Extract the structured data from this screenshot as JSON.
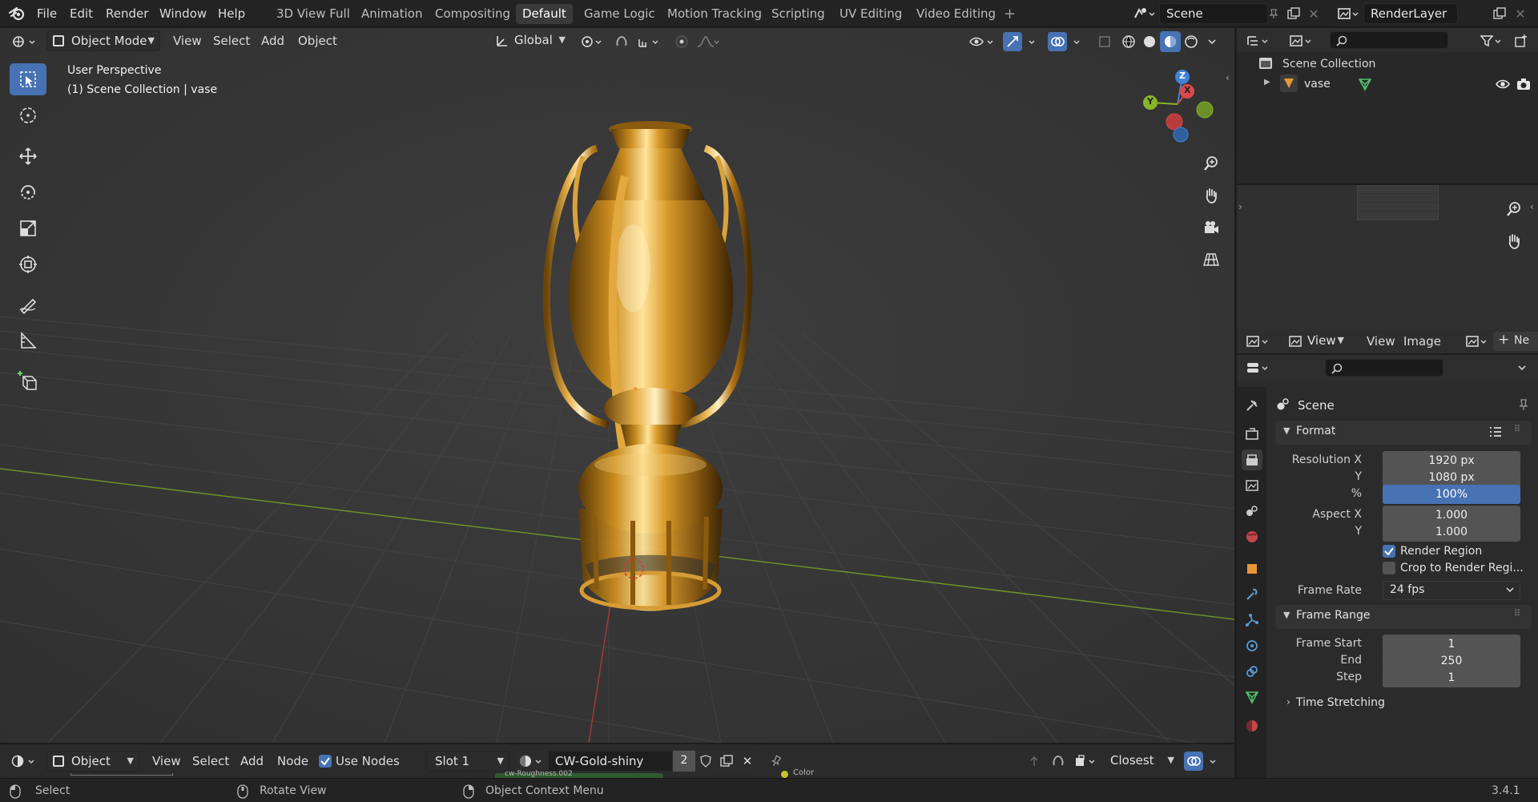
{
  "topbar": {
    "menu": [
      "File",
      "Edit",
      "Render",
      "Window",
      "Help"
    ],
    "workspaces": [
      "3D View Full",
      "Animation",
      "Compositing",
      "Default",
      "Game Logic",
      "Motion Tracking",
      "Scripting",
      "UV Editing",
      "Video Editing"
    ],
    "active_workspace": "Default",
    "add_tab": "+",
    "scene_name": "Scene",
    "view_layer": "RenderLayer"
  },
  "viewport_header": {
    "mode": "Object Mode",
    "menus": [
      "View",
      "Select",
      "Add",
      "Object"
    ],
    "orientation": "Global"
  },
  "viewport": {
    "perspective_label": "User Perspective",
    "collection_label": "(1) Scene Collection | vase",
    "gizmo_axes": [
      "Z",
      "X",
      "Y"
    ],
    "accent": "#4772b3",
    "axis_colors": {
      "x": "#d94a4a",
      "y": "#88b527",
      "z": "#3f84d6"
    }
  },
  "outliner": {
    "root": "Scene Collection",
    "items": [
      {
        "name": "vase"
      }
    ]
  },
  "image_editor": {
    "menus": [
      "View",
      "View",
      "Image"
    ],
    "new_label": "Ne"
  },
  "properties": {
    "context": "Scene",
    "format_panel": {
      "title": "Format",
      "resolution_x_label": "Resolution X",
      "resolution_x": "1920 px",
      "resolution_y_label": "Y",
      "resolution_y": "1080 px",
      "percent_label": "%",
      "percent": "100%",
      "percent_fill": 1.0,
      "aspect_x_label": "Aspect X",
      "aspect_x": "1.000",
      "aspect_y_label": "Y",
      "aspect_y": "1.000",
      "render_region_label": "Render Region",
      "render_region_checked": true,
      "crop_label": "Crop to Render Regi...",
      "crop_checked": false,
      "frame_rate_label": "Frame Rate",
      "frame_rate": "24 fps"
    },
    "frame_range_panel": {
      "title": "Frame Range",
      "start_label": "Frame Start",
      "start": "1",
      "end_label": "End",
      "end": "250",
      "step_label": "Step",
      "step": "1"
    },
    "time_stretching": "Time Stretching"
  },
  "node_header": {
    "type": "Object",
    "menus": [
      "View",
      "Select",
      "Add",
      "Node"
    ],
    "use_nodes_label": "Use Nodes",
    "use_nodes_checked": true,
    "slot": "Slot 1",
    "material": "CW-Gold-shiny",
    "users": "2",
    "interpolation": "Closest",
    "peek_text_1": "cw-Roughness.002",
    "peek_text_2": "Color"
  },
  "statusbar": {
    "select": "Select",
    "rotate": "Rotate View",
    "context_menu": "Object Context Menu",
    "version": "3.4.1"
  }
}
